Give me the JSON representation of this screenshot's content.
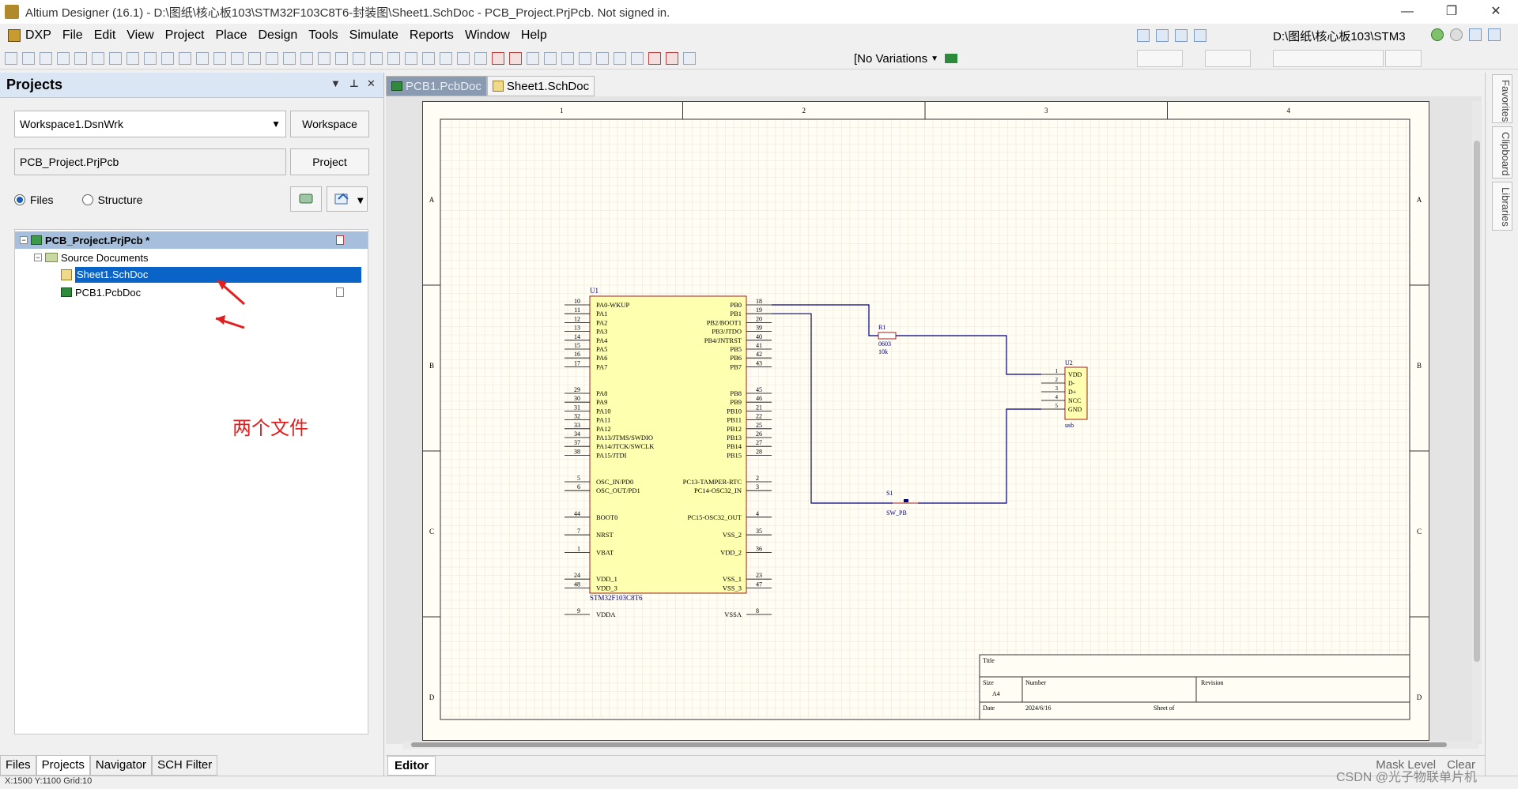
{
  "window": {
    "title": "Altium Designer (16.1) - D:\\图纸\\核心板103\\STM32F103C8T6-封装图\\Sheet1.SchDoc - PCB_Project.PrjPcb. Not signed in.",
    "minimize": "—",
    "restore": "❐",
    "close": "✕"
  },
  "menu": [
    "DXP",
    "File",
    "Edit",
    "View",
    "Project",
    "Place",
    "Design",
    "Tools",
    "Simulate",
    "Reports",
    "Window",
    "Help"
  ],
  "path_box": "D:\\图纸\\核心板103\\STM3",
  "variations": "[No Variations",
  "panel": {
    "title": "Projects",
    "workspace_field": "Workspace1.DsnWrk",
    "workspace_button": "Workspace",
    "project_field": "PCB_Project.PrjPcb",
    "project_button": "Project",
    "radio_files": "Files",
    "radio_structure": "Structure",
    "tree": {
      "project": "PCB_Project.PrjPcb *",
      "folder": "Source Documents",
      "files": [
        "Sheet1.SchDoc",
        "PCB1.PcbDoc"
      ]
    },
    "annotation": "两个文件",
    "bottom_tabs": [
      "Files",
      "Projects",
      "Navigator",
      "SCH Filter"
    ]
  },
  "doc_tabs": [
    "PCB1.PcbDoc",
    "Sheet1.SchDoc"
  ],
  "sheet": {
    "col_labels": [
      "1",
      "2",
      "3",
      "4"
    ],
    "row_labels": [
      "A",
      "B",
      "C",
      "D"
    ],
    "u1": {
      "designator": "U1",
      "comment": "STM32F103C8T6",
      "left_pins": [
        {
          "num": "10",
          "name": "PA0-WKUP"
        },
        {
          "num": "11",
          "name": "PA1"
        },
        {
          "num": "12",
          "name": "PA2"
        },
        {
          "num": "13",
          "name": "PA3"
        },
        {
          "num": "14",
          "name": "PA4"
        },
        {
          "num": "15",
          "name": "PA5"
        },
        {
          "num": "16",
          "name": "PA6"
        },
        {
          "num": "17",
          "name": "PA7"
        },
        {
          "num": "29",
          "name": "PA8"
        },
        {
          "num": "30",
          "name": "PA9"
        },
        {
          "num": "31",
          "name": "PA10"
        },
        {
          "num": "32",
          "name": "PA11"
        },
        {
          "num": "33",
          "name": "PA12"
        },
        {
          "num": "34",
          "name": "PA13/JTMS/SWDIO"
        },
        {
          "num": "37",
          "name": "PA14/JTCK/SWCLK"
        },
        {
          "num": "38",
          "name": "PA15/JTDI"
        },
        {
          "num": "5",
          "name": "OSC_IN/PD0"
        },
        {
          "num": "6",
          "name": "OSC_OUT/PD1"
        },
        {
          "num": "44",
          "name": "BOOT0"
        },
        {
          "num": "7",
          "name": "NRST"
        },
        {
          "num": "1",
          "name": "VBAT"
        },
        {
          "num": "24",
          "name": "VDD_1"
        },
        {
          "num": "48",
          "name": "VDD_3"
        },
        {
          "num": "9",
          "name": "VDDA"
        }
      ],
      "right_pins": [
        {
          "num": "18",
          "name": "PB0"
        },
        {
          "num": "19",
          "name": "PB1"
        },
        {
          "num": "20",
          "name": "PB2/BOOT1"
        },
        {
          "num": "39",
          "name": "PB3/JTDO"
        },
        {
          "num": "40",
          "name": "PB4/JNTRST"
        },
        {
          "num": "41",
          "name": "PB5"
        },
        {
          "num": "42",
          "name": "PB6"
        },
        {
          "num": "43",
          "name": "PB7"
        },
        {
          "num": "45",
          "name": "PB8"
        },
        {
          "num": "46",
          "name": "PB9"
        },
        {
          "num": "21",
          "name": "PB10"
        },
        {
          "num": "22",
          "name": "PB11"
        },
        {
          "num": "25",
          "name": "PB12"
        },
        {
          "num": "26",
          "name": "PB13"
        },
        {
          "num": "27",
          "name": "PB14"
        },
        {
          "num": "28",
          "name": "PB15"
        },
        {
          "num": "2",
          "name": "PC13-TAMPER-RTC"
        },
        {
          "num": "3",
          "name": "PC14-OSC32_IN"
        },
        {
          "num": "4",
          "name": "PC15-OSC32_OUT"
        },
        {
          "num": "35",
          "name": "VSS_2"
        },
        {
          "num": "36",
          "name": "VDD_2"
        },
        {
          "num": "23",
          "name": "VSS_1"
        },
        {
          "num": "47",
          "name": "VSS_3"
        },
        {
          "num": "8",
          "name": "VSSA"
        }
      ]
    },
    "r1": {
      "designator": "R1",
      "footprint": "0603",
      "value": "10k"
    },
    "u2": {
      "designator": "U2",
      "comment": "usb",
      "pins": [
        {
          "num": "1",
          "name": "VDD"
        },
        {
          "num": "2",
          "name": "D-"
        },
        {
          "num": "3",
          "name": "D+"
        },
        {
          "num": "4",
          "name": "NCC"
        },
        {
          "num": "5",
          "name": "GND"
        }
      ]
    },
    "s1": {
      "designator": "S1",
      "comment": "SW_PB"
    },
    "title_block": {
      "title": "Title",
      "size_label": "Size",
      "size_value": "A4",
      "number_label": "Number",
      "revision_label": "Revision",
      "date_label": "Date",
      "date_value": "2024/6/16",
      "sheet_label": "Sheet    of"
    }
  },
  "side_tabs": [
    "Favorites",
    "Clipboard",
    "Libraries"
  ],
  "editor_tab": "Editor",
  "editor_right": [
    "Mask Level",
    "Clear"
  ],
  "status_line": "X:1500 Y:1100   Grid:10",
  "watermark": "CSDN @光子物联单片机",
  "colors": {
    "sheet_bg": "#fffdf4",
    "component_fill": "#ffffb0",
    "component_border": "#a02020",
    "wire": "#00007f",
    "selection": "#0a64c8",
    "annotation": "#e02020"
  }
}
